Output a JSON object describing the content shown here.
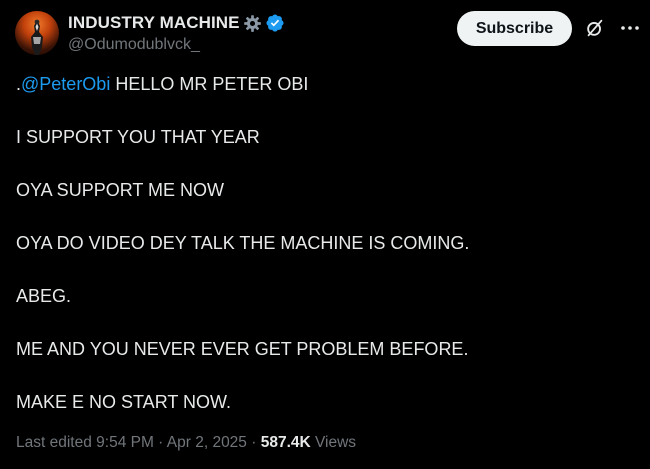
{
  "user": {
    "display_name": "INDUSTRY MACHINE",
    "handle": "@Odumodublvck_",
    "verified_color": "#1d9bf0"
  },
  "actions": {
    "subscribe_label": "Subscribe",
    "grok_icon": "grok-icon",
    "more_icon": "more-icon"
  },
  "tweet": {
    "line1_prefix": ".",
    "line1_mention": "@PeterObi",
    "line1_rest": " HELLO MR PETER OBI",
    "line2": "I SUPPORT YOU THAT YEAR",
    "line3": "OYA SUPPORT ME NOW",
    "line4": "OYA DO VIDEO DEY TALK THE MACHINE IS COMING.",
    "line5": "ABEG.",
    "line6": "ME AND YOU NEVER EVER GET PROBLEM BEFORE.",
    "line7": "MAKE E NO START NOW."
  },
  "meta": {
    "edited": "Last edited 9:54 PM · Apr 2, 2025 · ",
    "views_count": "587.4K",
    "views_label": " Views"
  },
  "colors": {
    "background": "#000000",
    "text": "#e7e9ea",
    "muted": "#71767b",
    "accent": "#1d9bf0"
  }
}
